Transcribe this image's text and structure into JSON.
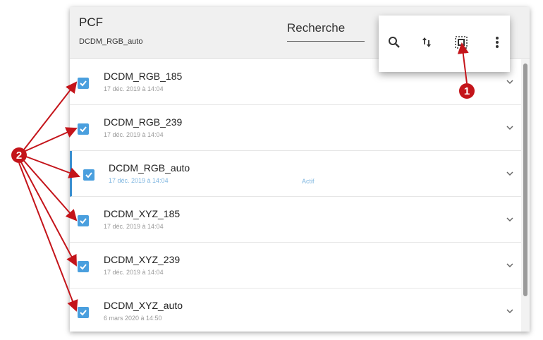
{
  "header": {
    "title": "PCF",
    "subtitle": "DCDM_RGB_auto",
    "search_label": "Recherche"
  },
  "toolbar": {
    "icons": [
      "search-icon",
      "sort-icon",
      "select-all-icon",
      "more-vert-icon"
    ]
  },
  "list": {
    "items": [
      {
        "name": "DCDM_RGB_185",
        "date": "17 déc. 2019 à 14:04",
        "status": "",
        "checked": true
      },
      {
        "name": "DCDM_RGB_239",
        "date": "17 déc. 2019 à 14:04",
        "status": "",
        "checked": true
      },
      {
        "name": "DCDM_RGB_auto",
        "date": "17 déc. 2019 à 14:04",
        "status": "Actif",
        "checked": true
      },
      {
        "name": "DCDM_XYZ_185",
        "date": "17 déc. 2019 à 14:04",
        "status": "",
        "checked": true
      },
      {
        "name": "DCDM_XYZ_239",
        "date": "17 déc. 2019 à 14:04",
        "status": "",
        "checked": true
      },
      {
        "name": "DCDM_XYZ_auto",
        "date": "6 mars 2020 à 14:50",
        "status": "",
        "checked": true
      }
    ]
  },
  "callouts": {
    "one": "1",
    "two": "2"
  },
  "colors": {
    "accent": "#4a9fde",
    "callout": "#c4141a",
    "active_border": "#3a8fd0"
  }
}
